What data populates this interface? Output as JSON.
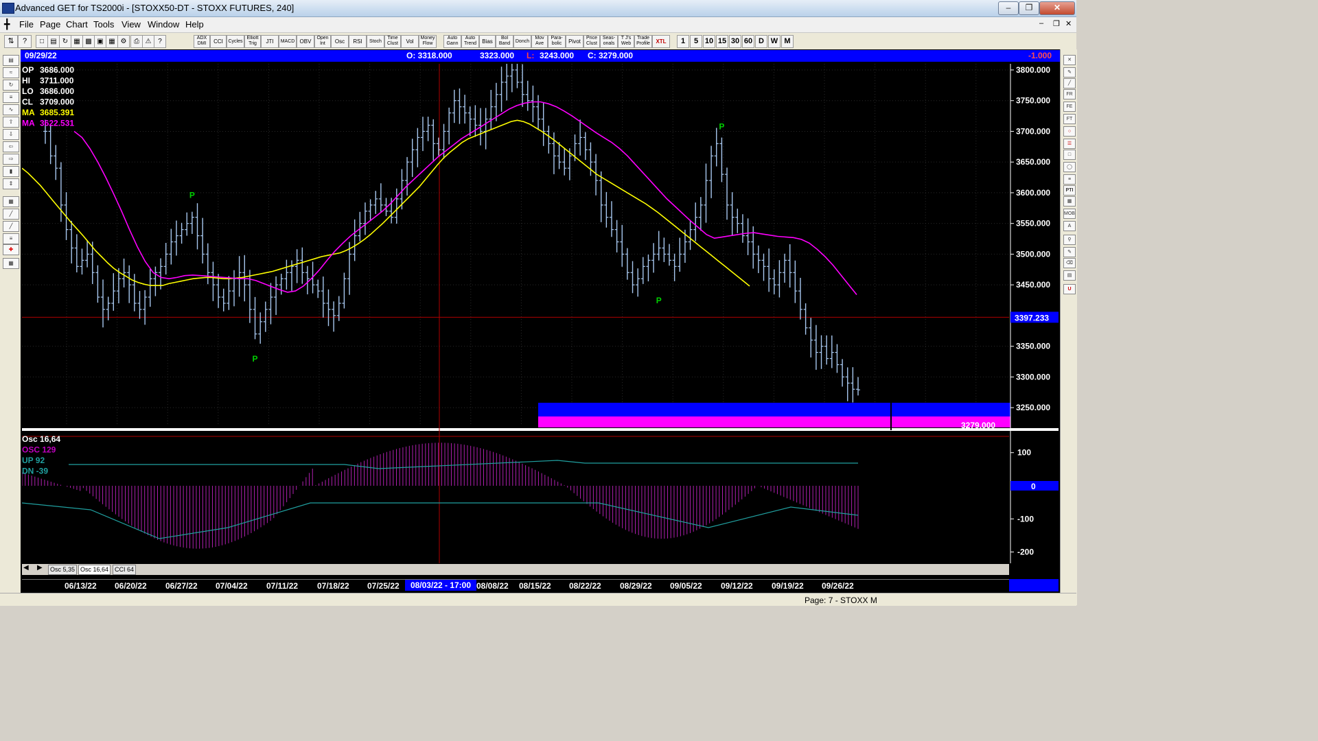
{
  "window": {
    "title": "Advanced GET for TS2000i - [STOXX50-DT - STOXX FUTURES, 240]"
  },
  "menu": [
    "File",
    "Page",
    "Chart",
    "Tools",
    "View",
    "Window",
    "Help"
  ],
  "toolbar": {
    "study_buttons": [
      "ADX DMI",
      "CCI",
      "Cycles",
      "Elliott Trig",
      "JTI",
      "MACD",
      "OBV",
      "Open Int",
      "Osc",
      "RSI",
      "Stoch",
      "Time Clust",
      "Vol",
      "Money Flow",
      "Auto Gann",
      "Auto Trend",
      "Bias",
      "Bol Band",
      "Donch",
      "Mov Ave",
      "Para-bolic",
      "Pivot",
      "Price Clust",
      "Seas-onals",
      "T J's Web",
      "Trade Profile",
      "XTL"
    ],
    "timeframes": [
      "1",
      "5",
      "10",
      "15",
      "30",
      "60",
      "D",
      "W",
      "M"
    ]
  },
  "info_bar": {
    "date": "09/29/22",
    "open": "O: 3318.000",
    "high": "3323.000",
    "low_prefix": "L:",
    "low": "3243.000",
    "close": "C: 3279.000",
    "change": "-1.000"
  },
  "stats": [
    {
      "label": "OP",
      "value": "3686.000",
      "color": "#ffffff"
    },
    {
      "label": "HI",
      "value": "3711.000",
      "color": "#ffffff"
    },
    {
      "label": "LO",
      "value": "3686.000",
      "color": "#ffffff"
    },
    {
      "label": "CL",
      "value": "3709.000",
      "color": "#ffffff"
    },
    {
      "label": "MA",
      "value": "3685.391",
      "color": "#ffff00"
    },
    {
      "label": "MA",
      "value": "3622.531",
      "color": "#ff00ff"
    }
  ],
  "osc_legend": [
    {
      "label": "Osc 16,64",
      "color": "#ffffff"
    },
    {
      "label": "OSC 129",
      "color": "#c000c0"
    },
    {
      "label": "UP   92",
      "color": "#20a0a0"
    },
    {
      "label": "DN   -39",
      "color": "#20a0a0"
    }
  ],
  "price_axis": {
    "current_price": "3397.233",
    "last_close_box": "3279.000"
  },
  "pivots": [
    {
      "label": "P",
      "date_index": 28,
      "price": 3578,
      "pos": "above"
    },
    {
      "label": "P",
      "date_index": 40,
      "price": 3345,
      "pos": "below"
    },
    {
      "label": "P",
      "date_index": 117,
      "price": 3440,
      "pos": "below"
    },
    {
      "label": "P",
      "date_index": 129,
      "price": 3690,
      "pos": "above"
    }
  ],
  "tabs": [
    "Osc 5,35",
    "Osc 16,64",
    "CCI 64"
  ],
  "dates": [
    "06/13/22",
    "06/20/22",
    "06/27/22",
    "07/04/22",
    "07/11/22",
    "07/18/22",
    "07/25/22",
    "08/08/22",
    "08/15/22",
    "08/22/22",
    "08/29/22",
    "09/05/22",
    "09/12/22",
    "09/19/22",
    "09/26/22"
  ],
  "cursor_date": "08/03/22 - 17:00",
  "status": "Page: 7 - STOXX M",
  "colors": {
    "background": "#000000",
    "ma_fast": "#ffff00",
    "ma_slow": "#ff00ff",
    "bars": "#a8c8f0",
    "osc": "#b020b0",
    "bands": "#20a0a0",
    "info": "#0000ff"
  },
  "chart_data": {
    "type": "line",
    "price_axis": {
      "ticks": [
        3800,
        3750,
        3700,
        3650,
        3600,
        3550,
        3500,
        3450,
        3350,
        3300,
        3250
      ],
      "ylim": [
        3220,
        3810
      ]
    },
    "osc_axis": {
      "ticks": [
        100,
        0,
        -100,
        -200
      ],
      "ylim": [
        -230,
        145
      ]
    },
    "series": [
      {
        "name": "MA",
        "values_ref": "ma_fast"
      },
      {
        "name": "MA",
        "values_ref": "ma_slow"
      }
    ],
    "close": [
      3700,
      3660,
      3640,
      3580,
      3540,
      3510,
      3480,
      3490,
      3500,
      3470,
      3430,
      3410,
      3420,
      3440,
      3460,
      3470,
      3450,
      3420,
      3410,
      3430,
      3460,
      3470,
      3480,
      3500,
      3520,
      3530,
      3540,
      3550,
      3560,
      3530,
      3500,
      3470,
      3450,
      3430,
      3420,
      3440,
      3460,
      3470,
      3450,
      3410,
      3370,
      3390,
      3410,
      3430,
      3450,
      3460,
      3470,
      3480,
      3490,
      3470,
      3460,
      3450,
      3440,
      3420,
      3410,
      3400,
      3420,
      3460,
      3500,
      3530,
      3550,
      3570,
      3580,
      3590,
      3580,
      3570,
      3560,
      3590,
      3620,
      3650,
      3670,
      3690,
      3700,
      3710,
      3680,
      3670,
      3700,
      3730,
      3750,
      3740,
      3730,
      3720,
      3710,
      3700,
      3720,
      3740,
      3760,
      3780,
      3790,
      3800,
      3780,
      3760,
      3750,
      3740,
      3720,
      3700,
      3680,
      3660,
      3650,
      3640,
      3660,
      3680,
      3690,
      3670,
      3650,
      3620,
      3580,
      3560,
      3540,
      3520,
      3500,
      3470,
      3450,
      3460,
      3480,
      3490,
      3500,
      3510,
      3500,
      3490,
      3480,
      3500,
      3520,
      3540,
      3560,
      3580,
      3620,
      3660,
      3680,
      3630,
      3580,
      3560,
      3550,
      3530,
      3520,
      3500,
      3490,
      3480,
      3460,
      3450,
      3470,
      3490,
      3470,
      3440,
      3410,
      3380,
      3360,
      3340,
      3350,
      3330,
      3340,
      3320,
      3300,
      3290,
      3280,
      3279
    ],
    "ma_fast": [
      3640,
      3632,
      3622,
      3612,
      3600,
      3588,
      3576,
      3564,
      3552,
      3541,
      3530,
      3518,
      3506,
      3496,
      3486,
      3477,
      3470,
      3464,
      3458,
      3454,
      3451,
      3449,
      3449,
      3449,
      3452,
      3454,
      3456,
      3458,
      3460,
      3461,
      3462,
      3462,
      3461,
      3460,
      3460,
      3461,
      3462,
      3464,
      3466,
      3468,
      3470,
      3472,
      3475,
      3478,
      3481,
      3484,
      3487,
      3490,
      3493,
      3496,
      3498,
      3500,
      3502,
      3506,
      3511,
      3517,
      3524,
      3532,
      3541,
      3550,
      3560,
      3570,
      3580,
      3590,
      3600,
      3610,
      3622,
      3634,
      3646,
      3657,
      3666,
      3674,
      3682,
      3688,
      3692,
      3696,
      3700,
      3704,
      3708,
      3712,
      3716,
      3718,
      3716,
      3712,
      3706,
      3700,
      3693,
      3686,
      3678,
      3670,
      3662,
      3654,
      3646,
      3638,
      3630,
      3624,
      3618,
      3612,
      3606,
      3600,
      3594,
      3588,
      3582,
      3575,
      3568,
      3560,
      3552,
      3544,
      3536,
      3528,
      3520,
      3512,
      3504,
      3496,
      3488,
      3480,
      3472,
      3464,
      3456,
      3448
    ],
    "ma_slow": [
      3700,
      3690,
      3672,
      3650,
      3625,
      3598,
      3570,
      3540,
      3512,
      3488,
      3470,
      3462,
      3460,
      3462,
      3465,
      3466,
      3465,
      3464,
      3463,
      3462,
      3461,
      3460,
      3460,
      3457,
      3452,
      3447,
      3442,
      3438,
      3440,
      3448,
      3460,
      3474,
      3490,
      3505,
      3518,
      3530,
      3540,
      3550,
      3560,
      3570,
      3582,
      3596,
      3610,
      3622,
      3634,
      3646,
      3658,
      3668,
      3678,
      3688,
      3696,
      3704,
      3712,
      3720,
      3728,
      3736,
      3742,
      3746,
      3748,
      3748,
      3745,
      3740,
      3733,
      3725,
      3716,
      3707,
      3698,
      3690,
      3682,
      3672,
      3660,
      3646,
      3632,
      3618,
      3604,
      3590,
      3578,
      3566,
      3554,
      3543,
      3532,
      3526,
      3528,
      3530,
      3532,
      3534,
      3535,
      3533,
      3531,
      3529,
      3528,
      3527,
      3524,
      3518,
      3508,
      3496,
      3482,
      3466,
      3450,
      3434
    ]
  }
}
